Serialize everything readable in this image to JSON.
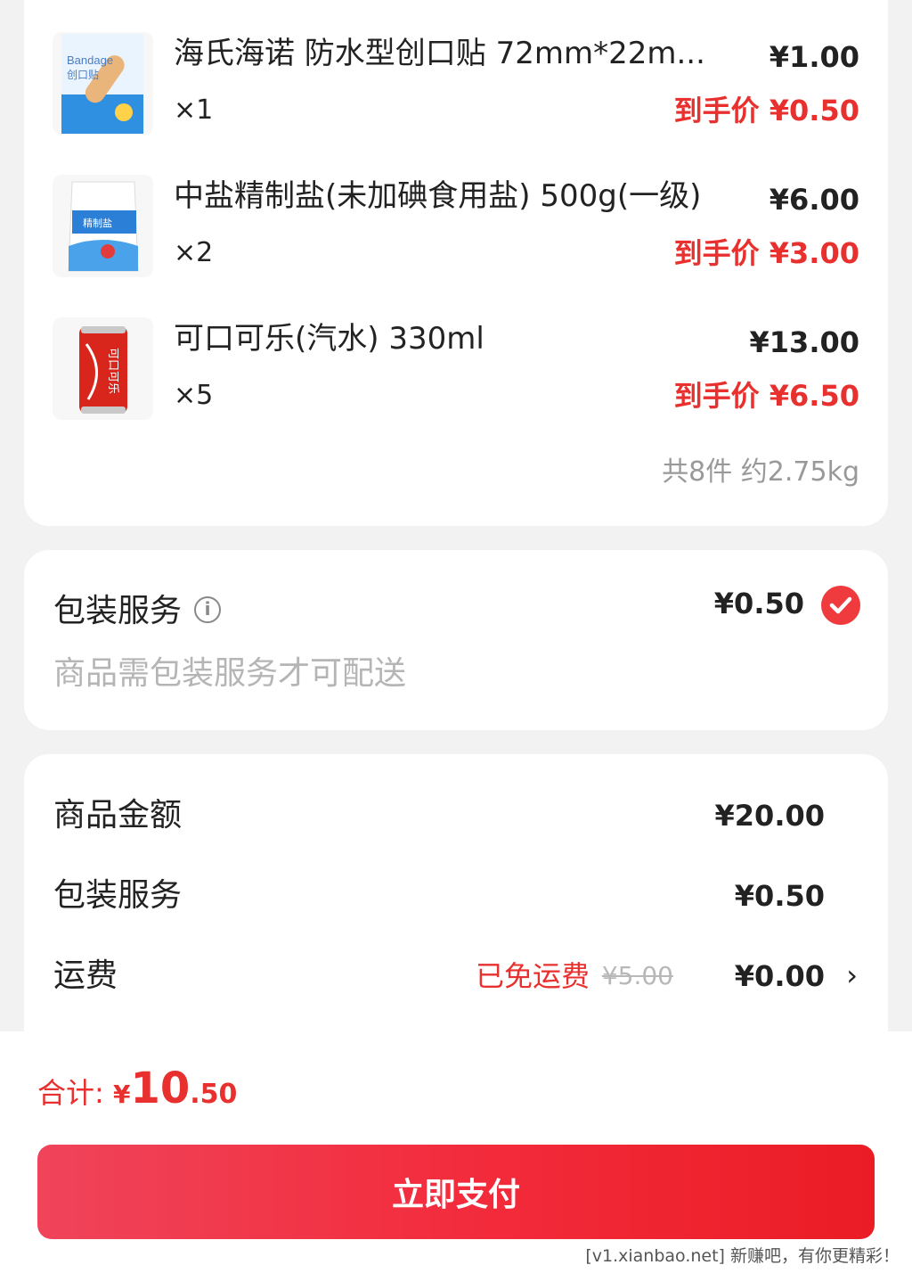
{
  "items": [
    {
      "name": "海氏海诺 防水型创口贴 72mm*22m...",
      "qty": "×1",
      "price": "¥1.00",
      "final_price": "到手价 ¥0.50",
      "thumb_icon": "bandage-package-image",
      "thumb_text_1": "Bandage",
      "thumb_text_2": "创口贴"
    },
    {
      "name": "中盐精制盐(未加碘食用盐) 500g(一级)",
      "qty": "×2",
      "price": "¥6.00",
      "final_price": "到手价 ¥3.00",
      "thumb_icon": "salt-bag-image",
      "thumb_text_1": "精制盐"
    },
    {
      "name": "可口可乐(汽水) 330ml",
      "qty": "×5",
      "price": "¥13.00",
      "final_price": "到手价 ¥6.50",
      "thumb_icon": "coke-can-image",
      "thumb_text_1": "可口可乐"
    }
  ],
  "items_total": "共8件 约2.75kg",
  "packaging": {
    "title": "包装服务",
    "info_icon": "info-icon",
    "price": "¥0.50",
    "checked": true,
    "note": "商品需包装服务才可配送"
  },
  "summary": {
    "goods_label": "商品金额",
    "goods_value": "¥20.00",
    "packaging_label": "包装服务",
    "packaging_value": "¥0.50",
    "shipping_label": "运费",
    "shipping_free": "已免运费",
    "shipping_original": "¥5.00",
    "shipping_value": "¥0.00"
  },
  "total": {
    "label": "合计:",
    "symbol": "¥",
    "int": "10",
    "dec": ".50"
  },
  "pay_button": "立即支付",
  "watermark": "[v1.xianbao.net] 新赚吧，有你更精彩！",
  "colors": {
    "accent": "#e8302f",
    "button_start": "#f0445a",
    "button_end": "#ea1d25",
    "background": "#f2f2f2"
  }
}
